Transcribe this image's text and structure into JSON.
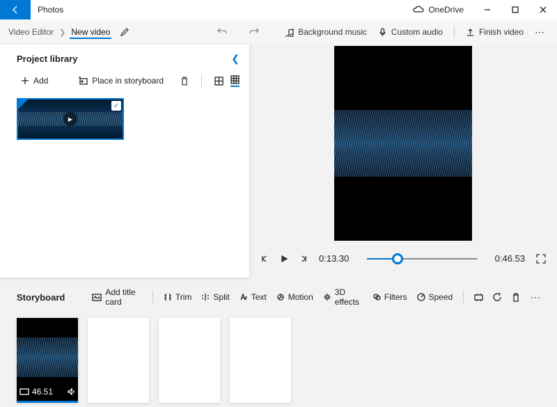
{
  "titlebar": {
    "app_name": "Photos",
    "onedrive_label": "OneDrive"
  },
  "cmdbar": {
    "crumb_root": "Video Editor",
    "crumb_current": "New video",
    "bg_music_label": "Background music",
    "custom_audio_label": "Custom audio",
    "finish_label": "Finish video"
  },
  "library": {
    "title": "Project library",
    "add_label": "Add",
    "place_label": "Place in storyboard"
  },
  "preview": {
    "current_time": "0:13.30",
    "total_time": "0:46.53"
  },
  "storyboard": {
    "title": "Storyboard",
    "add_title_card": "Add title card",
    "trim": "Trim",
    "split": "Split",
    "text": "Text",
    "motion": "Motion",
    "effects3d": "3D effects",
    "filters": "Filters",
    "speed": "Speed",
    "clip_duration": "46.51"
  }
}
